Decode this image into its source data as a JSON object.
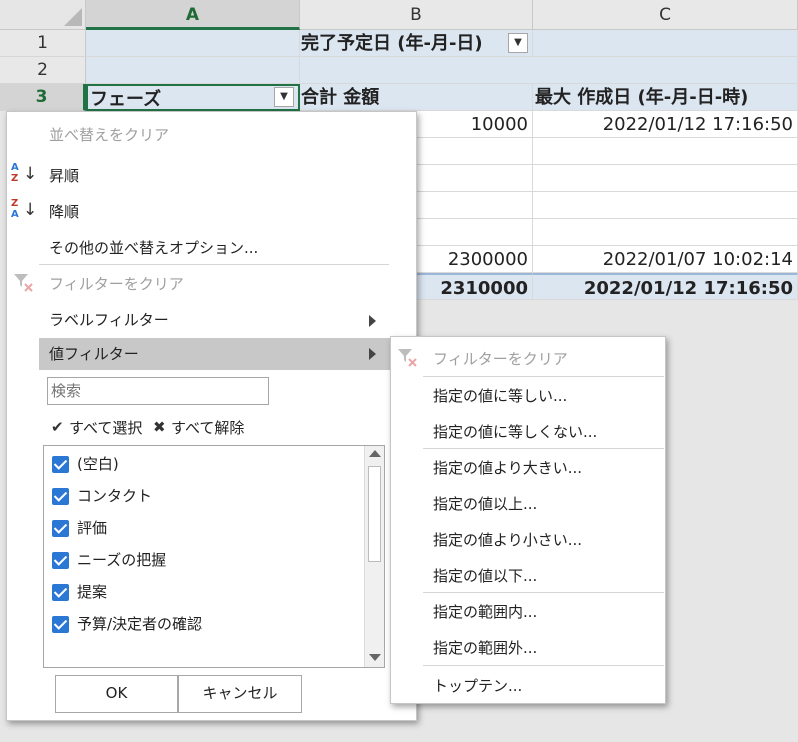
{
  "sheet": {
    "columns": [
      "A",
      "B",
      "C"
    ],
    "rows": [
      "1",
      "2",
      "3"
    ],
    "b1_label": "完了予定日 (年-月-日)",
    "a3_label": "フェーズ",
    "b3_label": "合計 金額",
    "c3_label": "最大 作成日 (年-月-日-時)",
    "data_rows": [
      {
        "amount": "10000",
        "date": "2022/01/12 17:16:50"
      },
      {
        "amount": "",
        "date": ""
      },
      {
        "amount": "",
        "date": ""
      },
      {
        "amount": "",
        "date": ""
      },
      {
        "amount": "2300000",
        "date": "2022/01/07 10:02:14"
      }
    ],
    "total_amount": "2310000",
    "total_date": "2022/01/12 17:16:50"
  },
  "filter_menu": {
    "clear_sort": "並べ替えをクリア",
    "ascending": "昇順",
    "descending": "降順",
    "more_sort": "その他の並べ替えオプション...",
    "clear_filter": "フィルターをクリア",
    "label_filter": "ラベルフィルター",
    "value_filter": "値フィルター",
    "search_placeholder": "検索",
    "select_all": "すべて選択",
    "clear_all": "すべて解除",
    "items": [
      "(空白)",
      "コンタクト",
      "評価",
      "ニーズの把握",
      "提案",
      "予算/決定者の確認"
    ],
    "ok": "OK",
    "cancel": "キャンセル"
  },
  "value_submenu": {
    "clear_filter": "フィルターをクリア",
    "equals": "指定の値に等しい...",
    "not_equals": "指定の値に等しくない...",
    "greater": "指定の値より大きい...",
    "greater_equal": "指定の値以上...",
    "less": "指定の値より小さい...",
    "less_equal": "指定の値以下...",
    "between": "指定の範囲内...",
    "not_between": "指定の範囲外...",
    "top10": "トップテン..."
  },
  "colors": {
    "accent": "#217346",
    "pivot_fill": "#dce6f1",
    "checkbox": "#2b78d4"
  }
}
